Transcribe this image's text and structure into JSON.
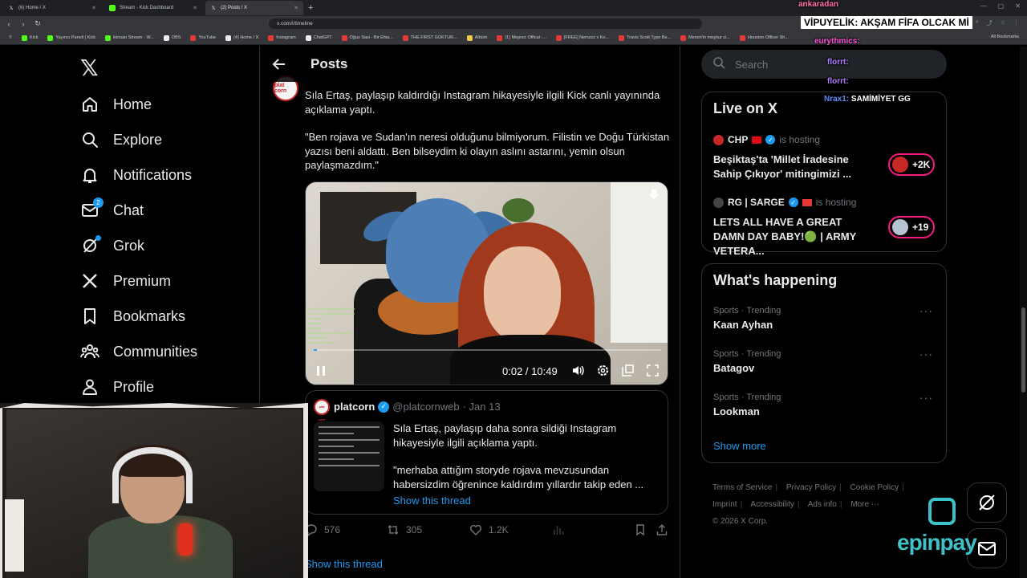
{
  "browser": {
    "tabs": [
      {
        "label": "(6) Home / X",
        "active": false,
        "icon": "x-icon"
      },
      {
        "label": "Stream - Kick Dashboard",
        "active": false,
        "icon": "kick-icon"
      },
      {
        "label": "(2) Posts / X",
        "active": true,
        "icon": "x-icon"
      }
    ],
    "url": "x.com/i/timeline",
    "bookmarks": [
      {
        "label": "Kick",
        "color": "green"
      },
      {
        "label": "Yayıncı Paneli | Kick",
        "color": "green"
      },
      {
        "label": "ikinsan Stream - W...",
        "color": "green"
      },
      {
        "label": "OBS",
        "color": "white"
      },
      {
        "label": "YouTube",
        "color": "red"
      },
      {
        "label": "(4) Home / X",
        "color": "white"
      },
      {
        "label": "Instagram",
        "color": "red"
      },
      {
        "label": "ChatGPT",
        "color": "white"
      },
      {
        "label": "Oğuz Sasi - Bir Efsa...",
        "color": "red"
      },
      {
        "label": "THE FIRST GOKTUR...",
        "color": "red"
      },
      {
        "label": "Albüm",
        "color": "yellow"
      },
      {
        "label": "(1) Meprez Offical -...",
        "color": "red"
      },
      {
        "label": "[FREE] Nemzzz x Ke...",
        "color": "red"
      },
      {
        "label": "Travis Scott Type Be...",
        "color": "red"
      },
      {
        "label": "Mersin'in meşhur ci...",
        "color": "red"
      },
      {
        "label": "Houston Officer Sh...",
        "color": "red"
      }
    ],
    "all_bookmarks": "All Bookmarks"
  },
  "nav": {
    "items": [
      {
        "label": "Home",
        "icon": "home-icon"
      },
      {
        "label": "Explore",
        "icon": "search-icon"
      },
      {
        "label": "Notifications",
        "icon": "bell-icon"
      },
      {
        "label": "Chat",
        "icon": "mail-icon",
        "badge": "2"
      },
      {
        "label": "Grok",
        "icon": "grok-icon"
      },
      {
        "label": "Premium",
        "icon": "x-icon"
      },
      {
        "label": "Bookmarks",
        "icon": "bookmark-icon"
      },
      {
        "label": "Communities",
        "icon": "people-icon"
      },
      {
        "label": "Profile",
        "icon": "person-icon"
      }
    ]
  },
  "header": {
    "title": "Posts"
  },
  "post": {
    "author": "platcorn",
    "avatar_text": "plat corn",
    "paragraphs": [
      "Sıla Ertaş, paylaşıp kaldırdığı Instagram hikayesiyle ilgili Kick canlı yayınında açıklama yaptı.",
      "\"Ben rojava ve Sudan'ın neresi olduğunu bilmiyorum. Filistin ve Doğu Türkistan yazısı beni aldattı. Ben bilseydim ki olayın aslını astarını, yemin olsun paylaşmazdım.\""
    ],
    "video": {
      "time": "0:02 / 10:49",
      "progress": 0.01,
      "chat_lines": [
        "sen ne ocak oynamilar yazdan ne",
        "emoriye o gomat baluyobile hmm",
        "alis ney alo",
        "kabadle e",
        "Ahiyarim",
        "Assgoalahn  ahalym de kayiy ey",
        "bordo  kelkanlı",
        "Bank  ama ne dediler"
      ]
    },
    "quote": {
      "name": "platcorn",
      "handle": "@platcornweb",
      "date": "· Jan 13",
      "paragraphs": [
        "Sıla Ertaş, paylaşıp daha sonra sildiği Instagram hikayesiyle ilgili açıklama yaptı.",
        "\"merhaba attığım storyde rojava mevzusundan habersizdim öğrenince kaldırdım yıllardır takip eden ..."
      ],
      "show_thread": "Show this thread"
    },
    "actions": {
      "replies": "576",
      "reposts": "305",
      "likes": "1.2K"
    },
    "show_thread": "Show this thread"
  },
  "search": {
    "placeholder": "Search"
  },
  "live": {
    "title": "Live on X",
    "items": [
      {
        "host": "CHP",
        "hosting": "is hosting",
        "title": "Beşiktaş'ta 'Millet İradesine Sahip Çıkıyor' mitingimizi ...",
        "count": "+2K"
      },
      {
        "host": "RG | SARGE",
        "hosting": "is hosting",
        "title": "LETS ALL HAVE A GREAT DAMN DAY BABY!🟢 | ARMY VETERA...",
        "count": "+19"
      }
    ]
  },
  "happening": {
    "title": "What's happening",
    "trends": [
      {
        "meta": "Sports · Trending",
        "name": "Kaan Ayhan"
      },
      {
        "meta": "Sports · Trending",
        "name": "Batagov"
      },
      {
        "meta": "Sports · Trending",
        "name": "Lookman"
      }
    ],
    "show_more": "Show more"
  },
  "footer": {
    "links": [
      "Terms of Service",
      "Privacy Policy",
      "Cookie Policy",
      "Imprint",
      "Accessibility",
      "Ads info",
      "More ···"
    ],
    "copyright": "© 2026 X Corp."
  },
  "stream_overlay": {
    "chat": [
      {
        "user": "ankaradan",
        "text": "",
        "color": "#ff6fa8"
      },
      {
        "user": "VİPUYELİK:",
        "text": "AKŞAM FİFA OLCAK Mİ",
        "banner": true
      },
      {
        "user": "eurythmics:",
        "text": "",
        "color": "#ff4fd8"
      },
      {
        "user": "florrt:",
        "text": "",
        "color": "#b07cff"
      },
      {
        "user": "florrt:",
        "text": "",
        "color": "#b07cff"
      },
      {
        "user": "Nrax1:",
        "text": "SAMİMİYET GG",
        "color": "#5b8cff"
      }
    ],
    "brand": "epinpay"
  },
  "colors": {
    "accent": "#1d9bf0",
    "live_ring": "#f91880",
    "brand": "#3ec1c9"
  }
}
